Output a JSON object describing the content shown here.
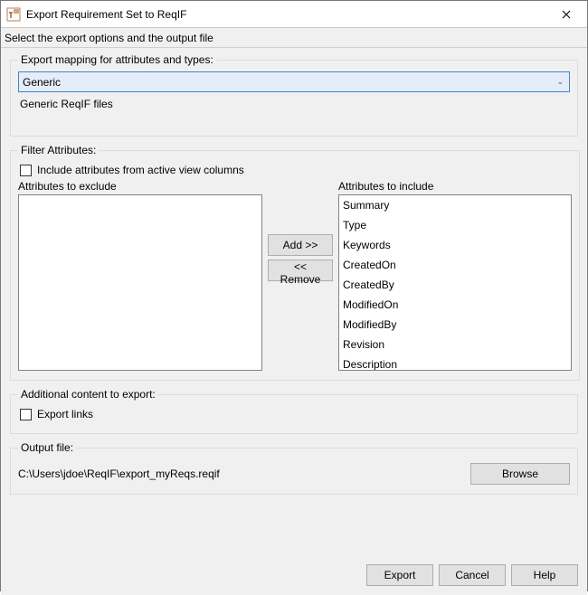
{
  "window": {
    "title": "Export Requirement Set to ReqIF",
    "subtitle": "Select the export options and the output file"
  },
  "mapping": {
    "legend": "Export mapping for attributes and types:",
    "selected": "Generic",
    "description": "Generic ReqIF files"
  },
  "filter": {
    "legend": "Filter Attributes:",
    "includeActiveViewLabel": "Include attributes from active view columns",
    "excludeLabel": "Attributes to exclude",
    "includeLabel": "Attributes to include",
    "addLabel": "Add >>",
    "removeLabel": "<< Remove",
    "excludeItems": [],
    "includeItems": [
      "Summary",
      "Type",
      "Keywords",
      "CreatedOn",
      "CreatedBy",
      "ModifiedOn",
      "ModifiedBy",
      "Revision",
      "Description"
    ]
  },
  "additional": {
    "legend": "Additional content to export:",
    "exportLinksLabel": "Export links"
  },
  "output": {
    "legend": "Output file:",
    "path": "C:\\Users\\jdoe\\ReqIF\\export_myReqs.reqif",
    "browseLabel": "Browse"
  },
  "buttons": {
    "export": "Export",
    "cancel": "Cancel",
    "help": "Help"
  }
}
